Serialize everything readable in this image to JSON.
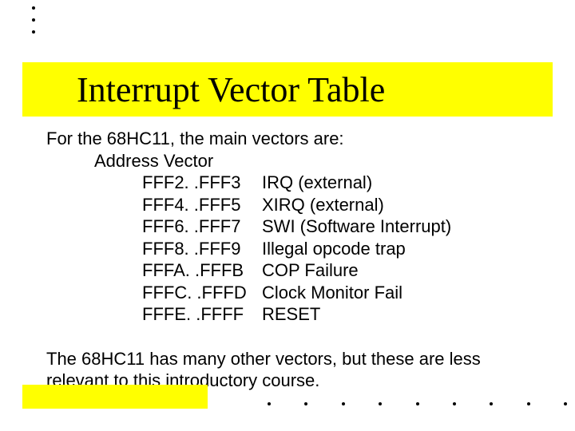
{
  "title": "Interrupt Vector Table",
  "intro": "For the 68HC11, the main vectors are:",
  "header_label": "Address Vector",
  "vectors": [
    {
      "addr": "FFF2. .FFF3",
      "desc": "IRQ (external)"
    },
    {
      "addr": "FFF4. .FFF5",
      "desc": "XIRQ (external)"
    },
    {
      "addr": "FFF6. .FFF7",
      "desc": "SWI (Software Interrupt)"
    },
    {
      "addr": "FFF8. .FFF9",
      "desc": "Illegal opcode trap"
    },
    {
      "addr": "FFFA. .FFFB",
      "desc": "COP Failure"
    },
    {
      "addr": "FFFC. .FFFD",
      "desc": "Clock Monitor Fail"
    },
    {
      "addr": "FFFE. .FFFF",
      "desc": "RESET"
    }
  ],
  "footer": "The 68HC11 has many other vectors, but these are less relevant to this introductory course."
}
